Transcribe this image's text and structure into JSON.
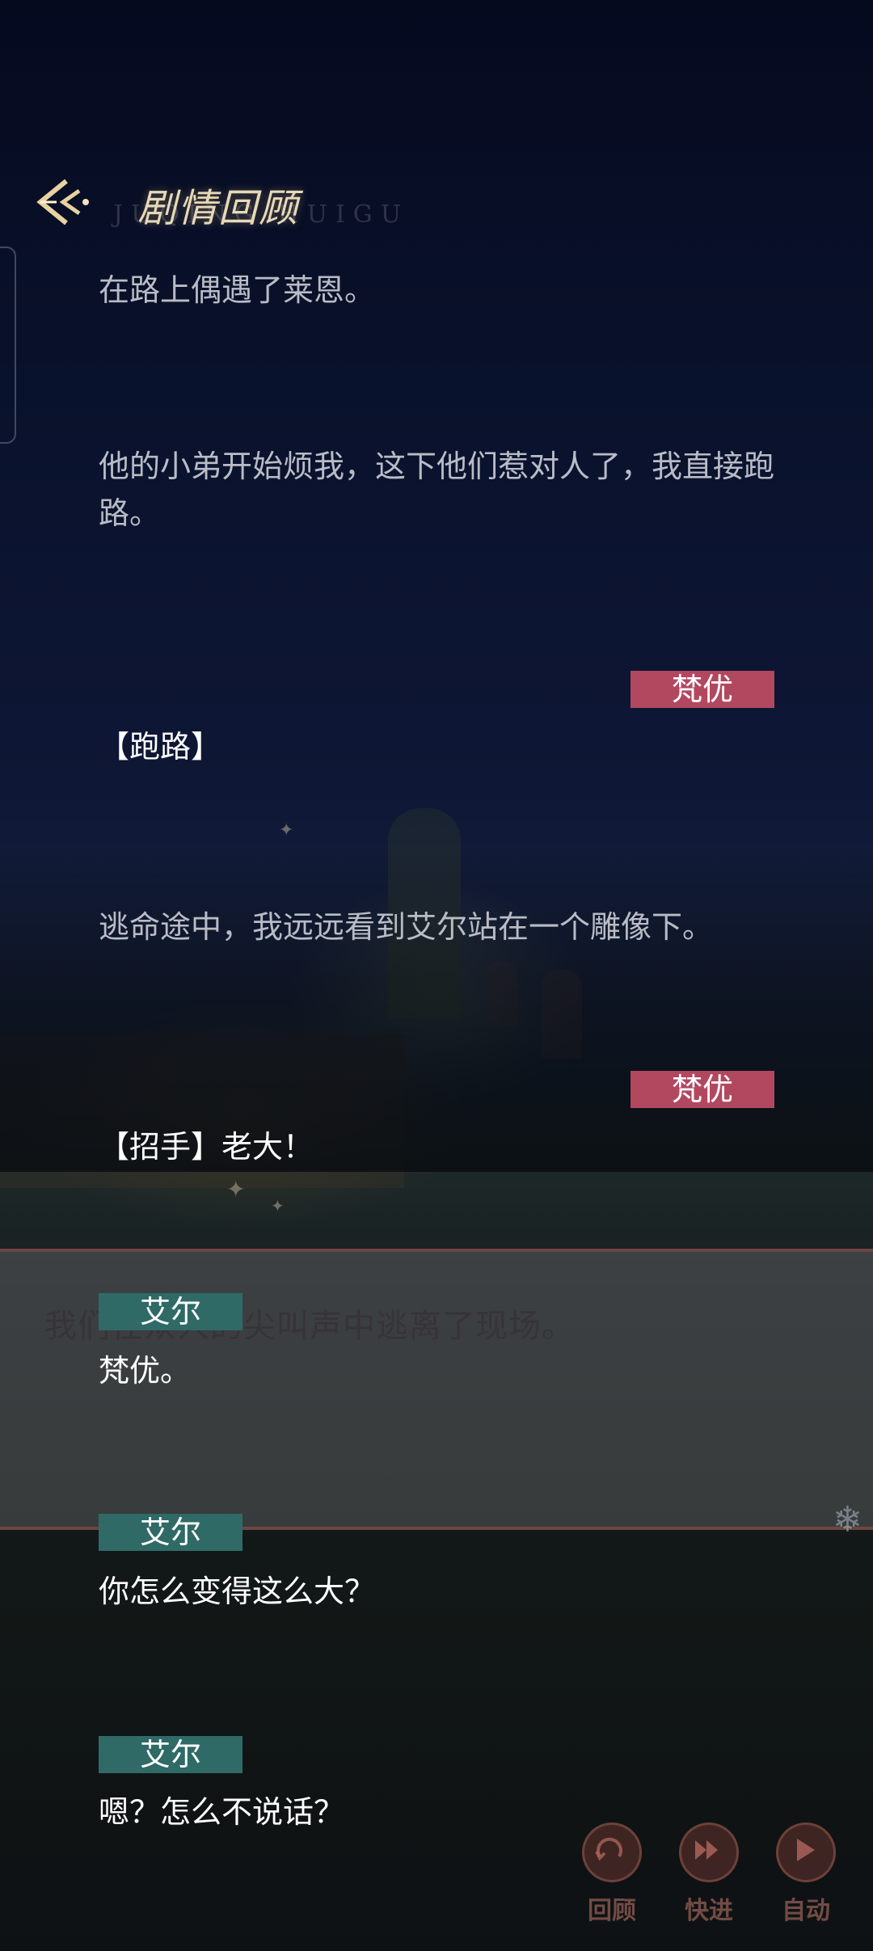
{
  "header": {
    "title": "剧情回顾",
    "subtitle": "JUQING HUIGU"
  },
  "entries": [
    {
      "type": "narration",
      "text": "在路上偶遇了莱恩。"
    },
    {
      "type": "narration",
      "text": "他的小弟开始烦我，这下他们惹对人了，我直接跑路。"
    },
    {
      "type": "dialogue",
      "speaker": "梵优",
      "text": "【跑路】"
    },
    {
      "type": "narration",
      "text": "逃命途中，我远远看到艾尔站在一个雕像下。"
    },
    {
      "type": "dialogue",
      "speaker": "梵优",
      "text": "【招手】老大！"
    },
    {
      "type": "dialogue",
      "speaker": "艾尔",
      "text": "梵优。"
    },
    {
      "type": "dialogue",
      "speaker": "艾尔",
      "text": "你怎么变得这么大？"
    },
    {
      "type": "dialogue",
      "speaker": "艾尔",
      "text": "嗯？怎么不说话？"
    }
  ],
  "background_text": "我们在众人的尖叫声中逃离了现场。",
  "controls": [
    {
      "label": "回顾",
      "icon": "history-icon"
    },
    {
      "label": "快进",
      "icon": "fast-forward-icon"
    },
    {
      "label": "自动",
      "icon": "play-icon"
    }
  ],
  "colors": {
    "speaker_fan_you": "#b24760",
    "speaker_ai_er": "#2f6a66",
    "title_gold": "#e8d9b6"
  }
}
